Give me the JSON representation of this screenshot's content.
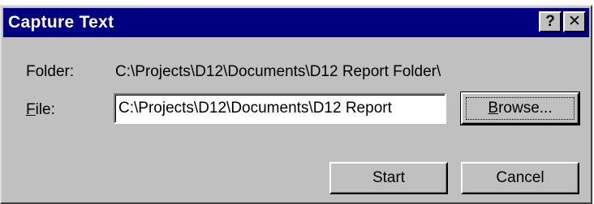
{
  "window": {
    "title": "Capture Text",
    "help_label": "?",
    "close_label": "✕"
  },
  "folder": {
    "label": "Folder:",
    "value": "C:\\Projects\\D12\\Documents\\D12 Report Folder\\"
  },
  "file": {
    "label_mnemonic": "F",
    "label_rest": "ile:",
    "value": "C:\\Projects\\D12\\Documents\\D12 Report"
  },
  "buttons": {
    "browse_mnemonic": "B",
    "browse_rest": "rowse...",
    "start": "Start",
    "cancel": "Cancel"
  }
}
